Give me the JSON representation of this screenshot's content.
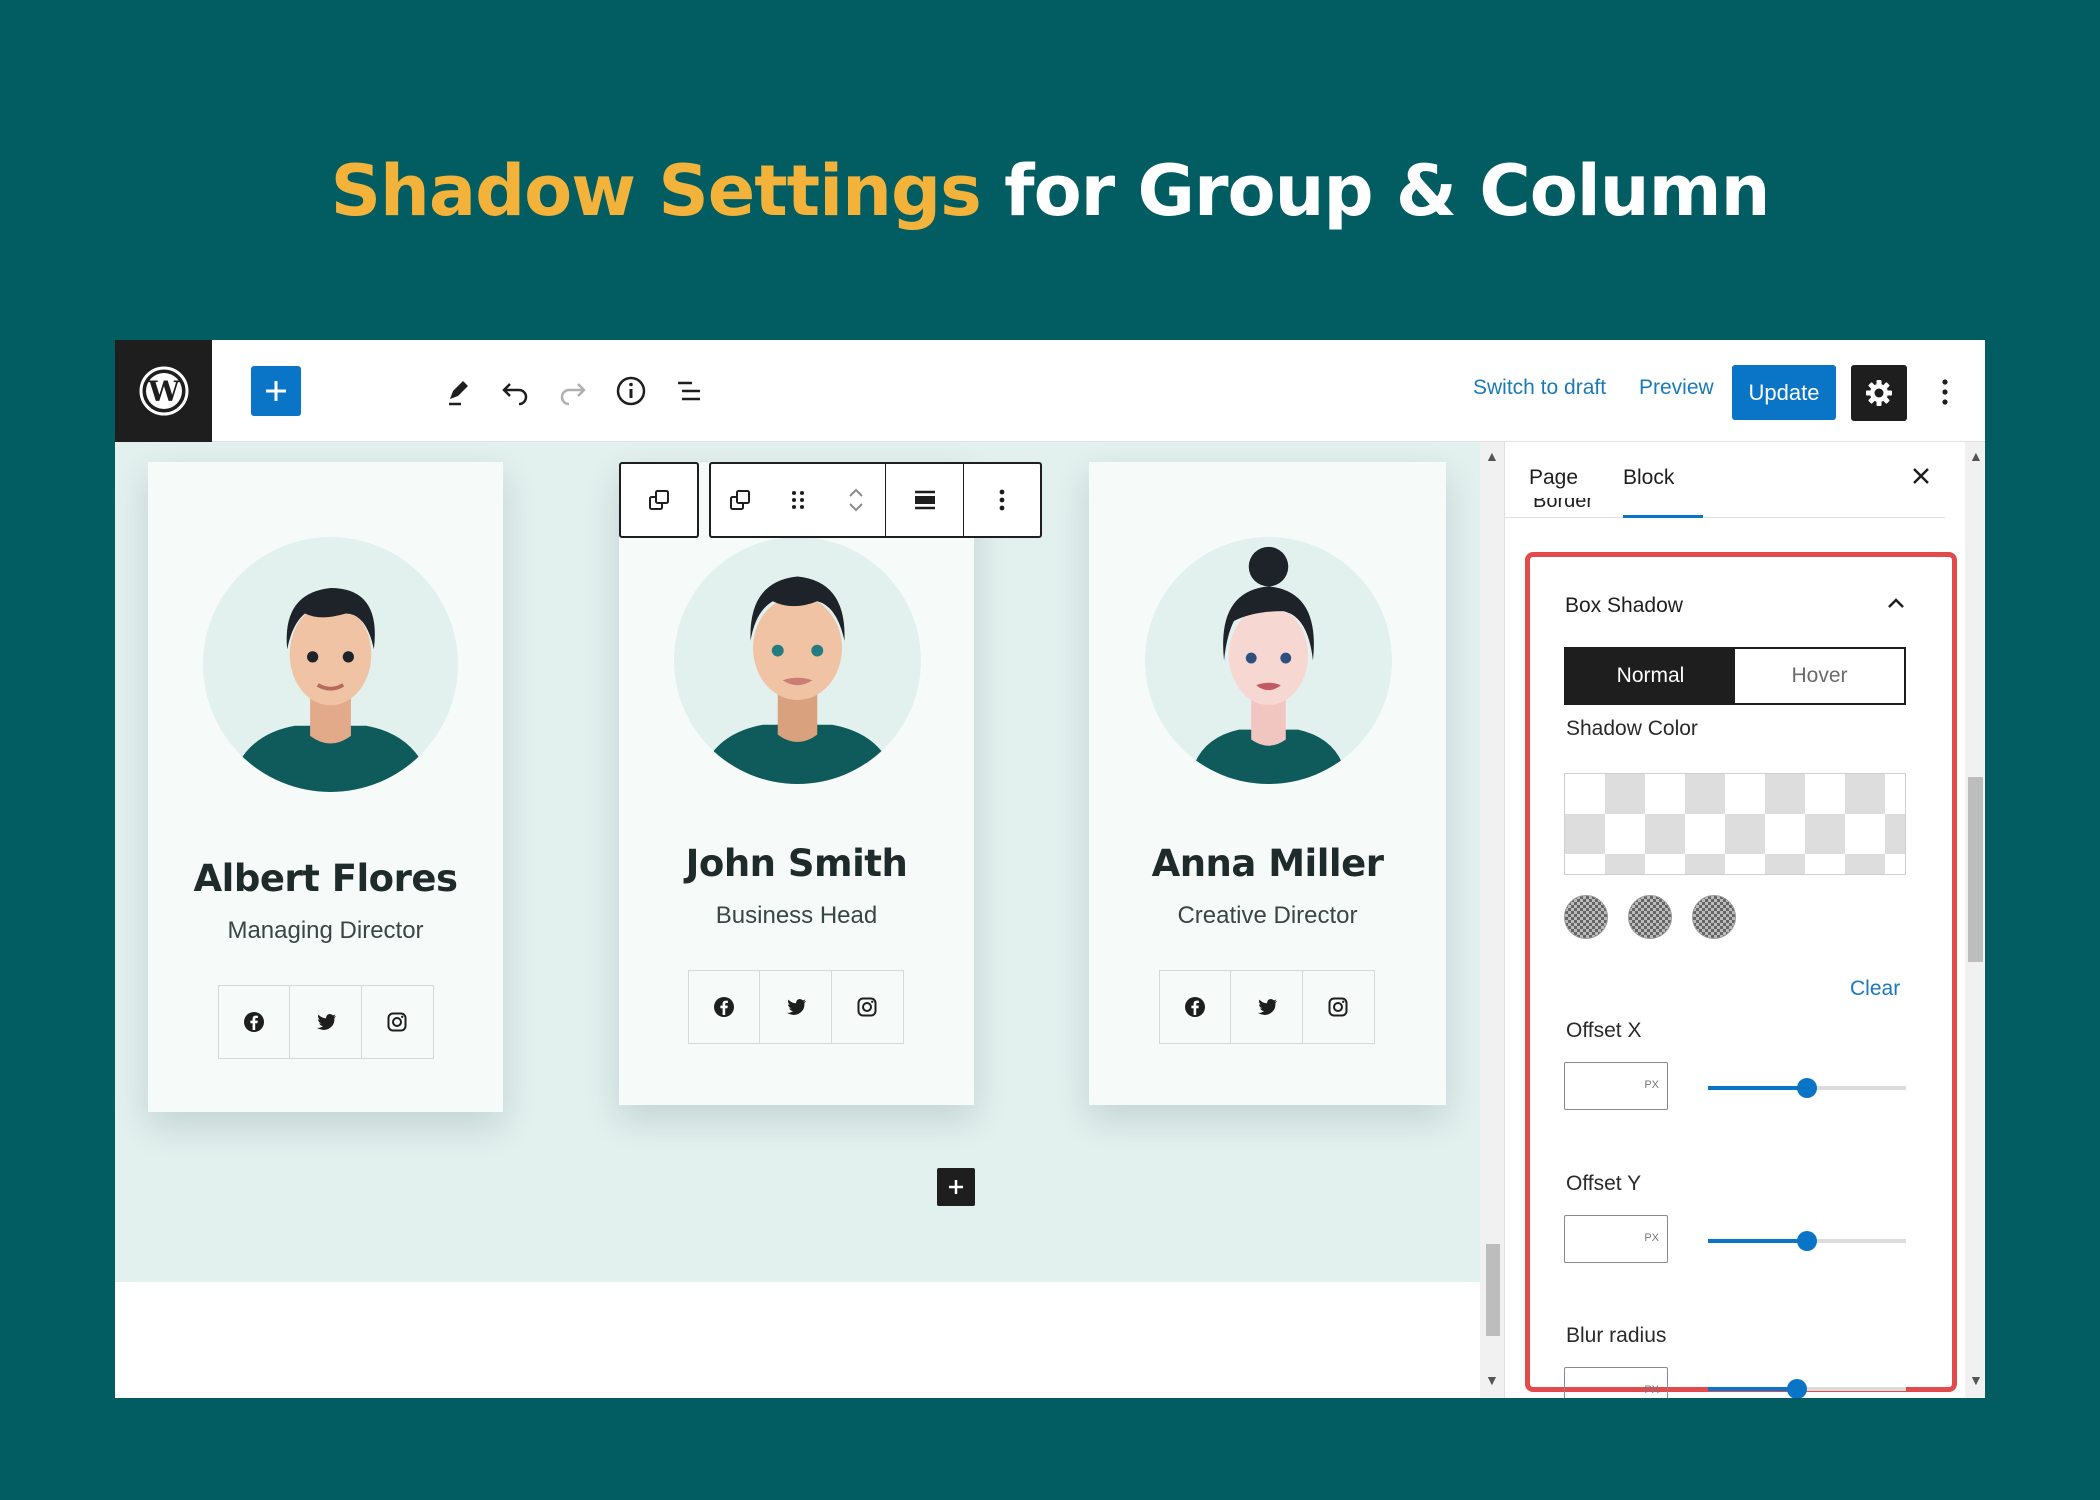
{
  "headline": {
    "highlight": "Shadow Settings",
    "rest": "for Group & Column"
  },
  "toolbar": {
    "switch_to_draft": "Switch to draft",
    "preview": "Preview",
    "update": "Update"
  },
  "cards": [
    {
      "name": "Albert Flores",
      "role": "Managing Director"
    },
    {
      "name": "John Smith",
      "role": "Business Head"
    },
    {
      "name": "Anna Miller",
      "role": "Creative Director"
    }
  ],
  "sidebar": {
    "tabs": {
      "page": "Page",
      "block": "Block"
    },
    "peek_label": "Border",
    "panel": {
      "title": "Box Shadow",
      "states": {
        "normal": "Normal",
        "hover": "Hover"
      },
      "shadow_color_label": "Shadow Color",
      "clear": "Clear",
      "offset_x_label": "Offset X",
      "offset_y_label": "Offset Y",
      "blur_label": "Blur radius",
      "unit": "PX",
      "offset_x_level": 0.5,
      "offset_y_level": 0.5,
      "blur_level": 0.45
    }
  },
  "colors": {
    "accent": "#0a74c7",
    "highlight_outline": "#e24b4b",
    "headline_highlight": "#f3b23a",
    "background": "#025d62"
  }
}
